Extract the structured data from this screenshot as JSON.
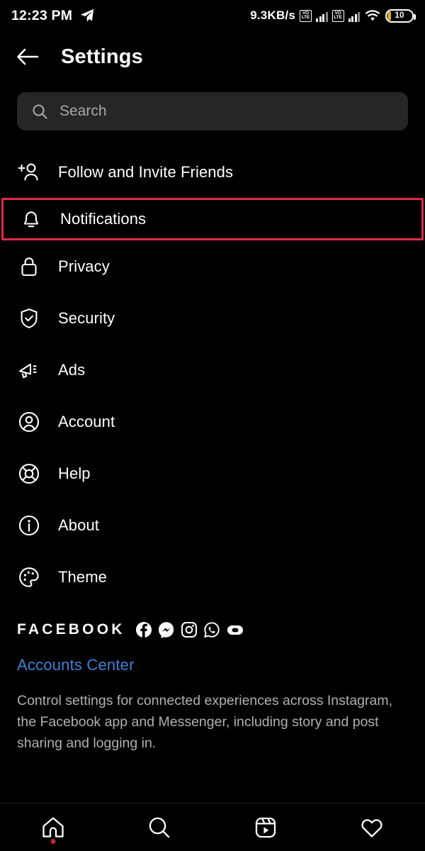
{
  "status_bar": {
    "time": "12:23 PM",
    "send_icon": "telegram-send-icon",
    "network_speed": "9.3KB/s",
    "volte_top": "VO",
    "volte_bottom": "LTE",
    "sim1_icon": "volte-signal-icon",
    "sim2_icon": "volte-signal-icon",
    "wifi_icon": "wifi-icon",
    "battery_level": "10",
    "battery_color": "#d8a72b"
  },
  "header": {
    "back_icon": "back-arrow-icon",
    "title": "Settings"
  },
  "search": {
    "icon": "search-icon",
    "placeholder": "Search",
    "value": "",
    "background": "#262626"
  },
  "settings_list": [
    {
      "label": "Follow and Invite Friends",
      "icon": "person-add-icon",
      "highlighted": false
    },
    {
      "label": "Notifications",
      "icon": "bell-icon",
      "highlighted": true
    },
    {
      "label": "Privacy",
      "icon": "lock-icon",
      "highlighted": false
    },
    {
      "label": "Security",
      "icon": "shield-check-icon",
      "highlighted": false
    },
    {
      "label": "Ads",
      "icon": "megaphone-icon",
      "highlighted": false
    },
    {
      "label": "Account",
      "icon": "person-circle-icon",
      "highlighted": false
    },
    {
      "label": "Help",
      "icon": "life-ring-icon",
      "highlighted": false
    },
    {
      "label": "About",
      "icon": "info-circle-icon",
      "highlighted": false
    },
    {
      "label": "Theme",
      "icon": "palette-icon",
      "highlighted": false
    }
  ],
  "highlight_color": "#e1294a",
  "facebook_section": {
    "wordmark": "FACEBOOK",
    "brand_icons": [
      "facebook-icon",
      "messenger-icon",
      "instagram-icon",
      "whatsapp-icon",
      "portal-icon"
    ],
    "accounts_center_link": "Accounts Center",
    "accounts_center_color": "#3e82d6",
    "description": "Control settings for connected experiences across Instagram, the Facebook app and Messenger, including story and post sharing and logging in."
  },
  "bottom_nav": [
    {
      "name": "home",
      "icon": "home-icon",
      "badge": true
    },
    {
      "name": "search",
      "icon": "search-icon",
      "badge": false
    },
    {
      "name": "reels",
      "icon": "reels-icon",
      "badge": false
    },
    {
      "name": "activity",
      "icon": "heart-icon",
      "badge": false
    }
  ]
}
